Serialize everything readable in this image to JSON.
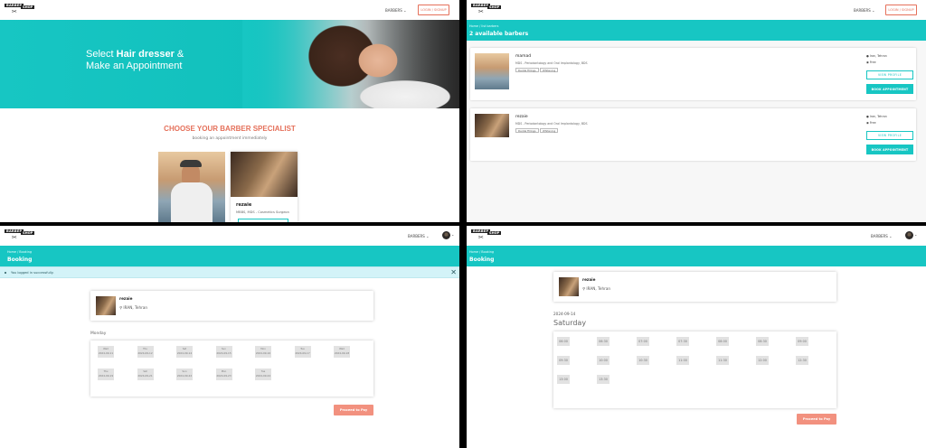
{
  "logo": {
    "word1": "BARBER",
    "word2": "SHOP"
  },
  "nav": {
    "barbers_label": "BARBERS ⌄",
    "login_label": "LOGIN / SIGNUP"
  },
  "home": {
    "hero_line1_pre": "Select ",
    "hero_line1_bold": "Hair dresser",
    "hero_line1_post": " &",
    "hero_line2": "Make an Appointment",
    "section_title": "CHOOSE YOUR BARBER SPECIALIST",
    "section_sub": "booking an appointment immediately",
    "card2_name": "rezaie",
    "card2_spec": "MBBS, MDS - Cosmetics Surgeon"
  },
  "listing": {
    "breadcrumb": "Home  /  list barbers",
    "title": "2 available barbers",
    "barbers": [
      {
        "name": "mamad",
        "spec": "MDS - Periodontology and Oral Implantology, BDS",
        "tags": [
          "Dental Fillings",
          "Whitening"
        ],
        "city": "Iran, Tehran",
        "price": "Free",
        "view_label": "VIEW PROFILE",
        "book_label": "BOOK APPOINTMENT"
      },
      {
        "name": "rezaie",
        "spec": "MDS - Periodontology and Oral Implantology, BDS",
        "tags": [
          "Dental Fillings",
          "Whitening"
        ],
        "city": "Iran, Tehran",
        "price": "Free",
        "view_label": "VIEW PROFILE",
        "book_label": "BOOK APPOINTMENT"
      }
    ]
  },
  "booking1": {
    "breadcrumb": "Home  /  Booking",
    "title": "Booking",
    "alert": "You logged in successfully.",
    "close_glyph": "✕",
    "barber_name": "rezaie",
    "barber_loc": "IRAN, Tehran",
    "day_label": "Monday",
    "slots": [
      {
        "d": "Wed",
        "t": "2024-09-11"
      },
      {
        "d": "Thu",
        "t": "2024-09-12"
      },
      {
        "d": "Sat",
        "t": "2024-09-14"
      },
      {
        "d": "Sun",
        "t": "2024-09-15"
      },
      {
        "d": "Mon",
        "t": "2024-09-16"
      },
      {
        "d": "Tue",
        "t": "2024-09-17"
      },
      {
        "d": "Wed",
        "t": "2024-09-18"
      },
      {
        "d": "Thu",
        "t": "2024-09-19"
      },
      {
        "d": "Sat",
        "t": "2024-09-21"
      },
      {
        "d": "Sun",
        "t": "2024-09-22"
      },
      {
        "d": "Mon",
        "t": "2024-09-23"
      },
      {
        "d": "Tue",
        "t": "2024-09-24"
      }
    ],
    "pay_label": "Proceed to Pay"
  },
  "booking2": {
    "breadcrumb": "Home  /  Booking",
    "title": "Booking",
    "barber_name": "rezaie",
    "barber_loc": "IRAN, Tehran",
    "date": "2024-09-14",
    "weekday": "Saturday",
    "times": [
      "06:00",
      "06:30",
      "07:00",
      "07:30",
      "08:00",
      "08:30",
      "09:00",
      "09:30",
      "10:00",
      "10:30",
      "11:00",
      "11:30",
      "12:00",
      "12:30",
      "13:00",
      "13:30"
    ],
    "pay_label": "Proceed to Pay"
  }
}
